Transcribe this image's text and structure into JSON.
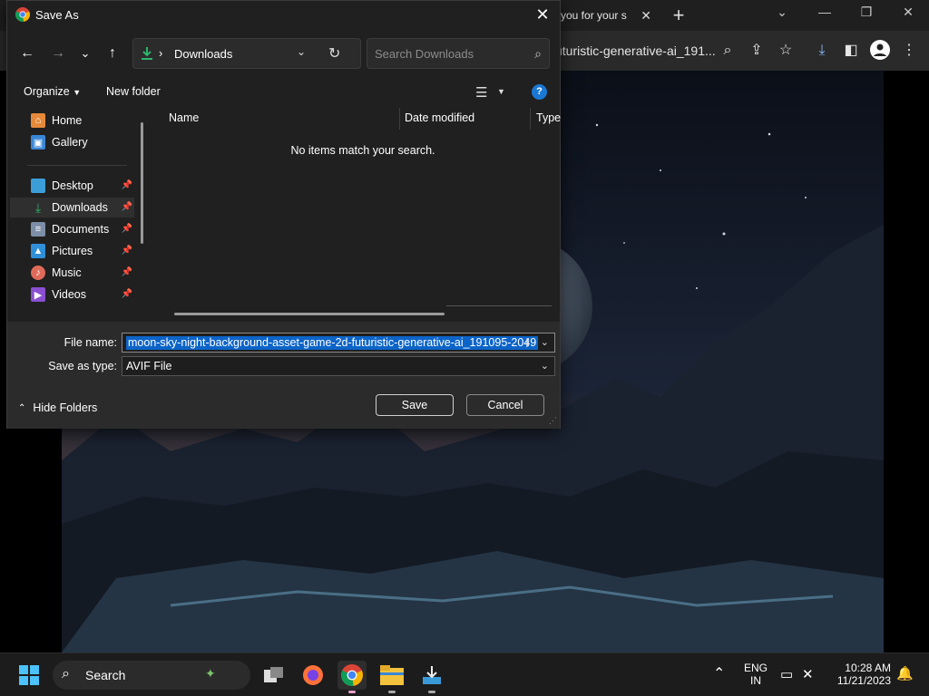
{
  "browser": {
    "tab_title": "you for your s",
    "omnibox_text": "uturistic-generative-ai_191...",
    "new_tab_glyph": "+",
    "tab_close_glyph": "✕"
  },
  "dialog": {
    "title": "Save As",
    "nav": {
      "back": "←",
      "forward": "→",
      "recent": "⌄",
      "up": "↑",
      "breadcrumb_sep": "›",
      "breadcrumb": "Downloads",
      "refresh": "↻",
      "search_placeholder": "Search Downloads"
    },
    "commands": {
      "organize": "Organize",
      "new_folder": "New folder"
    },
    "sidebar": {
      "items": [
        {
          "label": "Home",
          "icon": "home-icon"
        },
        {
          "label": "Gallery",
          "icon": "gallery-icon"
        },
        {
          "label": "Desktop",
          "icon": "desktop-icon",
          "pinned": true
        },
        {
          "label": "Downloads",
          "icon": "downloads-icon",
          "pinned": true,
          "selected": true
        },
        {
          "label": "Documents",
          "icon": "documents-icon",
          "pinned": true
        },
        {
          "label": "Pictures",
          "icon": "pictures-icon",
          "pinned": true
        },
        {
          "label": "Music",
          "icon": "music-icon",
          "pinned": true
        },
        {
          "label": "Videos",
          "icon": "videos-icon",
          "pinned": true
        }
      ]
    },
    "file_list": {
      "columns": [
        "Name",
        "Date modified",
        "Type"
      ],
      "empty_message": "No items match your search."
    },
    "form": {
      "file_name_label": "File name:",
      "file_name_value": "moon-sky-night-background-asset-game-2d-futuristic-generative-ai_191095-2049",
      "save_type_label": "Save as type:",
      "save_type_value": "AVIF File",
      "hide_folders": "Hide Folders",
      "save": "Save",
      "cancel": "Cancel"
    }
  },
  "taskbar": {
    "search_label": "Search",
    "lang_line1": "ENG",
    "lang_line2": "IN",
    "time": "10:28 AM",
    "date": "11/21/2023"
  },
  "colors": {
    "accent": "#1a78d4",
    "selection": "#0c64c8",
    "dialog_bg": "#202020",
    "form_bg": "#2b2b2b"
  }
}
